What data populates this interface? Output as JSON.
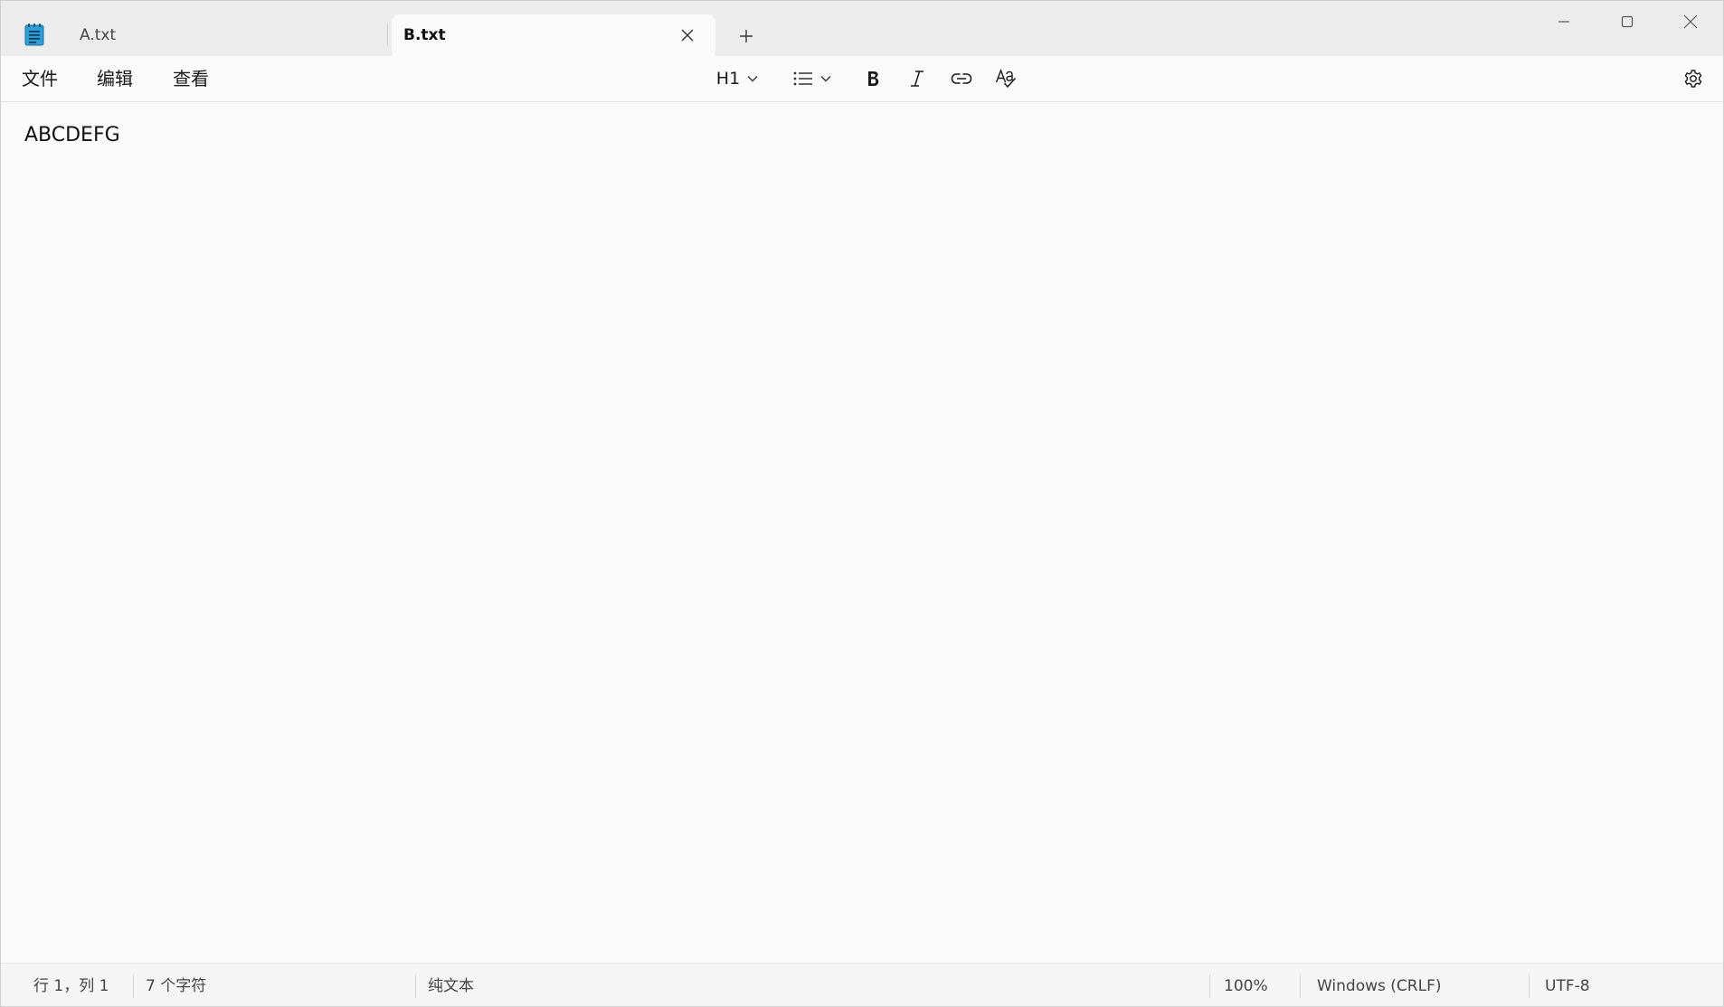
{
  "tabs": [
    {
      "label": "A.txt",
      "active": false
    },
    {
      "label": "B.txt",
      "active": true
    }
  ],
  "menu": {
    "file": "文件",
    "edit": "编辑",
    "view": "查看"
  },
  "toolbar": {
    "heading_label": "H1"
  },
  "editor": {
    "content": "ABCDEFG"
  },
  "status": {
    "position": "行 1，列 1",
    "char_count": "7 个字符",
    "format": "纯文本",
    "zoom": "100%",
    "line_ending": "Windows (CRLF)",
    "encoding": "UTF-8"
  },
  "colors": {
    "titlebar_bg": "#ececec",
    "editor_bg": "#fafafa",
    "app_icon_blue": "#2b9fd8"
  },
  "icons": {
    "app": "notepad-icon",
    "tab_close": "close-icon",
    "tab_add": "plus-icon",
    "minimize": "minimize-icon",
    "maximize": "maximize-icon",
    "close": "close-icon",
    "heading_dropdown": "chevron-down-icon",
    "list": "bulleted-list-icon",
    "bold": "bold-icon",
    "italic": "italic-icon",
    "link": "link-icon",
    "spellcheck": "spellcheck-icon",
    "settings": "gear-icon"
  }
}
